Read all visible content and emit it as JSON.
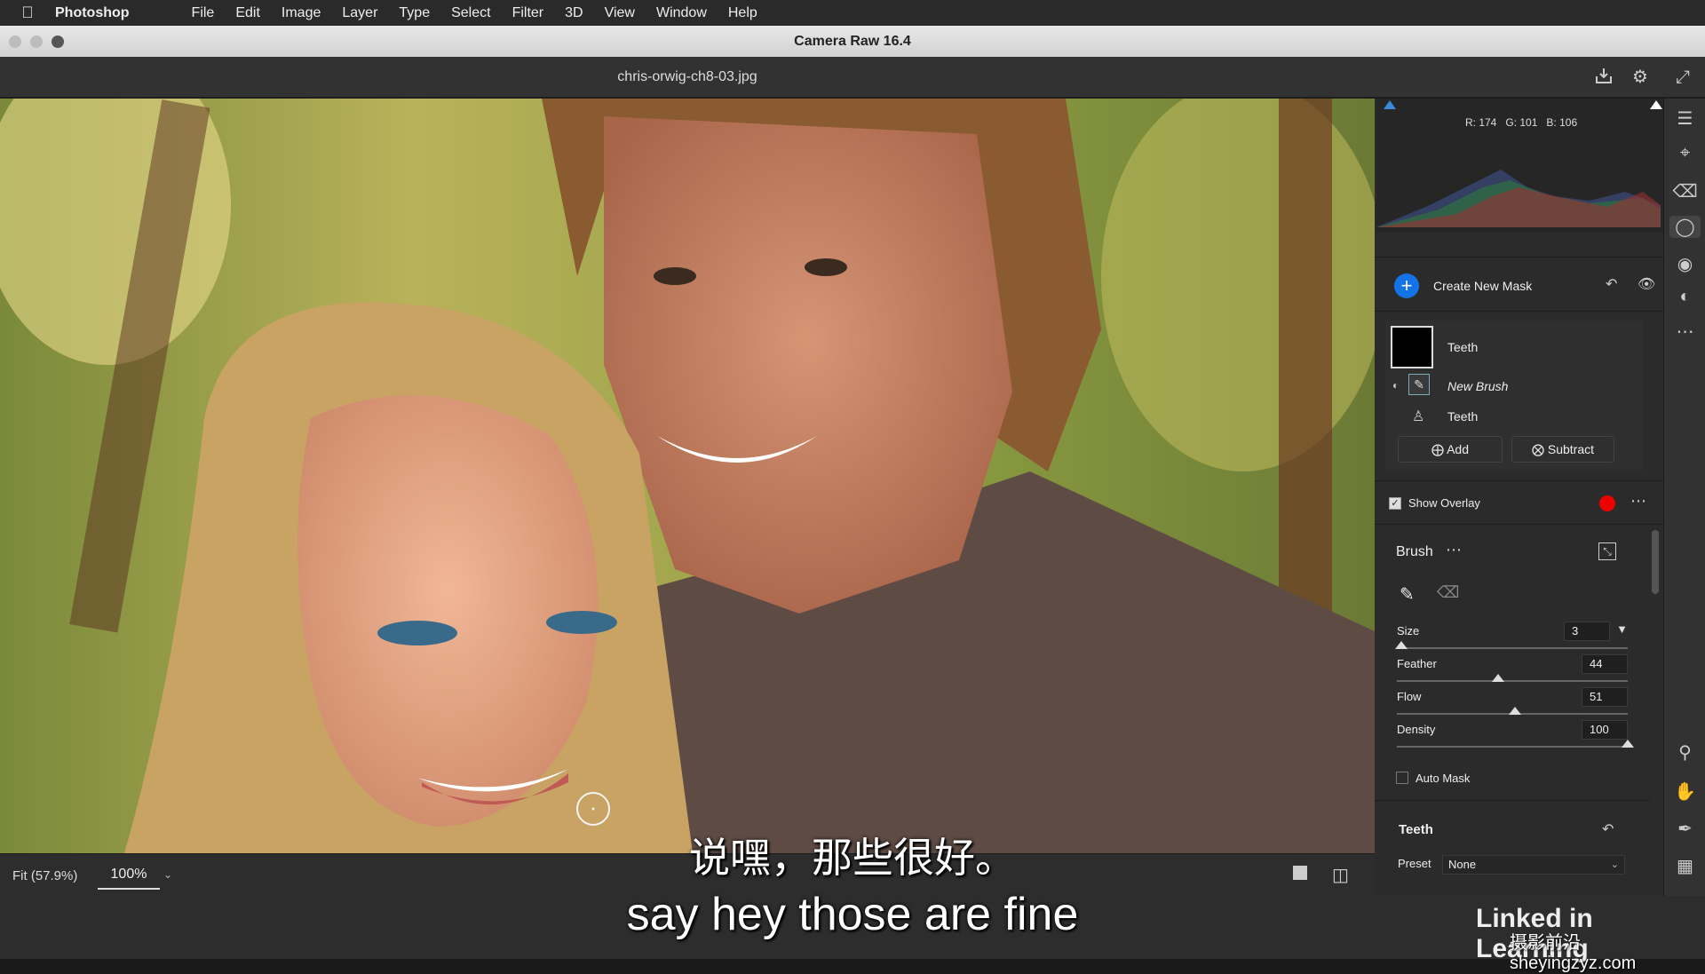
{
  "menubar": {
    "app": "Photoshop",
    "items": [
      "File",
      "Edit",
      "Image",
      "Layer",
      "Type",
      "Select",
      "Filter",
      "3D",
      "View",
      "Window",
      "Help"
    ]
  },
  "window": {
    "title": "Camera Raw 16.4"
  },
  "header": {
    "filename": "chris-orwig-ch8-03.jpg"
  },
  "bottombar": {
    "fit": "Fit (57.9%)",
    "zoom": "100%"
  },
  "histogram": {
    "r": "R: 174",
    "g": "G: 101",
    "b": "B: 106"
  },
  "masks": {
    "create_label": "Create New Mask",
    "mask_name": "Teeth",
    "component_name": "New Brush",
    "subject_name": "Teeth",
    "add_label": "Add",
    "subtract_label": "Subtract"
  },
  "overlay": {
    "label": "Show Overlay",
    "checked": true,
    "color": "#ee0000"
  },
  "brush": {
    "title": "Brush",
    "sliders": [
      {
        "label": "Size",
        "value": "3",
        "fraction": 0.02
      },
      {
        "label": "Feather",
        "value": "44",
        "fraction": 0.44
      },
      {
        "label": "Flow",
        "value": "51",
        "fraction": 0.51
      },
      {
        "label": "Density",
        "value": "100",
        "fraction": 1.0
      }
    ],
    "auto_mask": "Auto Mask"
  },
  "teeth_section": {
    "title": "Teeth",
    "preset_label": "Preset",
    "preset_value": "None"
  },
  "subtitles": {
    "cn": "说嘿，那些很好。",
    "en": "say hey those are fine"
  },
  "branding": {
    "logo": "Linked in Learning",
    "watermark": "摄影前沿sheyingzyz.com"
  }
}
